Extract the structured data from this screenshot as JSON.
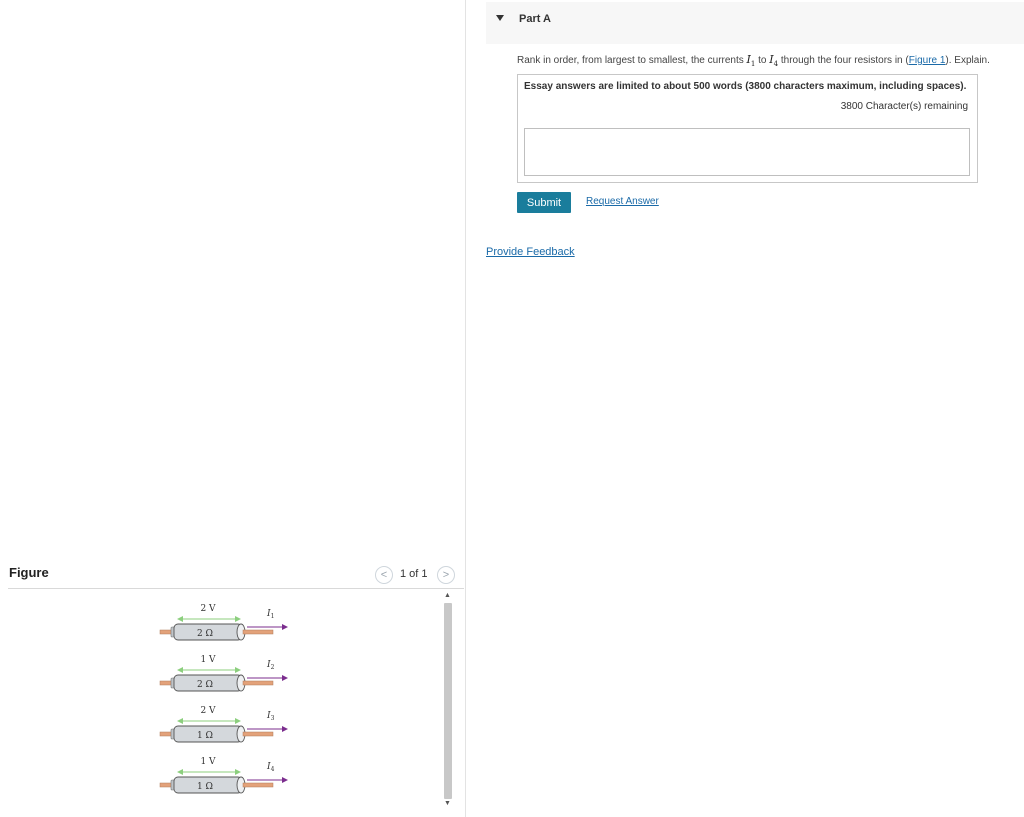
{
  "part": {
    "title": "Part A"
  },
  "question": {
    "prefix": "Rank in order, from largest to smallest, the currents ",
    "var_start": "I",
    "var_start_sub": "1",
    "middle": " to ",
    "var_end": "I",
    "var_end_sub": "4",
    "suffix_before_link": " through the four resistors in (",
    "figure_link": "Figure 1",
    "suffix": "). Explain."
  },
  "essay": {
    "limit_text": "Essay answers are limited to about 500 words (3800 characters maximum, including spaces).",
    "remaining_text": "3800 Character(s) remaining",
    "value": ""
  },
  "actions": {
    "submit_label": "Submit",
    "request_label": "Request Answer",
    "feedback_label": "Provide Feedback"
  },
  "figure": {
    "title": "Figure",
    "pager_text": "1 of 1",
    "prev_symbol": "<",
    "next_symbol": ">",
    "resistors": [
      {
        "voltage": "2 V",
        "resistance": "2 Ω",
        "current_symbol": "I",
        "current_sub": "1"
      },
      {
        "voltage": "1 V",
        "resistance": "2 Ω",
        "current_symbol": "I",
        "current_sub": "2"
      },
      {
        "voltage": "2 V",
        "resistance": "1 Ω",
        "current_symbol": "I",
        "current_sub": "3"
      },
      {
        "voltage": "1 V",
        "resistance": "1 Ω",
        "current_symbol": "I",
        "current_sub": "4"
      }
    ]
  },
  "colors": {
    "submit_bg": "#1a7d9c",
    "link": "#1a6aa8",
    "voltage_arrow": "#8ccf7e",
    "current_arrow": "#7b2d8e",
    "wire": "#e3a27a",
    "resistor_body": "#d4d8dc"
  }
}
